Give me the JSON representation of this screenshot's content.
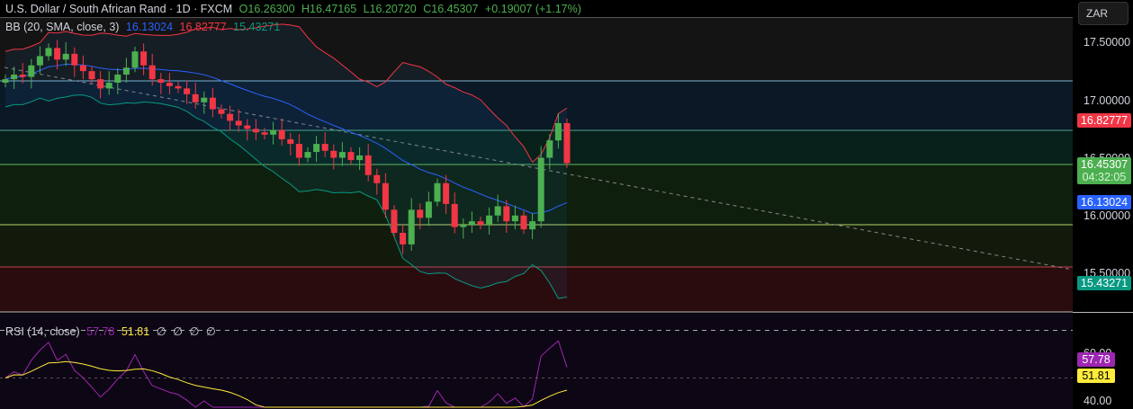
{
  "header": {
    "symbol": "U.S. Dollar / South African Rand · 1D · FXCM",
    "open": "O16.26300",
    "high": "H16.47165",
    "low": "L16.20720",
    "close": "C16.45307",
    "change": "+0.19007 (+1.17%)"
  },
  "bb": {
    "label": "BB (20, SMA, close, 3)",
    "basis": "16.13024",
    "upper": "16.82777",
    "lower": "15.43271"
  },
  "rsi": {
    "label": "RSI (14, close)",
    "value": "57.78",
    "ma": "51.81",
    "extras": [
      "∅",
      "∅",
      "∅",
      "∅"
    ]
  },
  "axis": {
    "currency": "ZAR",
    "ticks": [
      "17.50000",
      "17.00000",
      "16.50000",
      "16.00000",
      "15.50000"
    ],
    "rsi_ticks": [
      "60.00",
      "40.00"
    ],
    "labels": {
      "upper": "16.82777",
      "price": "16.45307",
      "countdown": "04:32:05",
      "basis": "16.13024",
      "lower": "15.43271",
      "rsi": "57.78",
      "rsi_ma": "51.81"
    }
  },
  "colors": {
    "up": "#4caf50",
    "down": "#f23645",
    "basis": "#2962ff",
    "upper": "#f23645",
    "lower": "#089981",
    "rsi": "#9c27b0",
    "rsi_ma": "#ffeb3b"
  },
  "chart_data": {
    "type": "candlestick",
    "ylim": [
      15.2,
      17.75
    ],
    "rsi_ylim": [
      40,
      70
    ],
    "closes": [
      17.18,
      17.22,
      17.2,
      17.3,
      17.38,
      17.45,
      17.35,
      17.4,
      17.3,
      17.25,
      17.18,
      17.1,
      17.15,
      17.22,
      17.28,
      17.42,
      17.3,
      17.18,
      17.15,
      17.12,
      17.1,
      17.05,
      16.98,
      17.02,
      16.92,
      16.88,
      16.82,
      16.78,
      16.75,
      16.72,
      16.7,
      16.74,
      16.66,
      16.62,
      16.5,
      16.55,
      16.62,
      16.56,
      16.5,
      16.55,
      16.48,
      16.52,
      16.35,
      16.28,
      16.05,
      15.85,
      15.75,
      16.05,
      15.98,
      16.12,
      16.28,
      16.1,
      15.9,
      15.92,
      15.95,
      15.92,
      16.0,
      16.08,
      15.95,
      16.0,
      15.88,
      15.95,
      16.5,
      16.65,
      16.8,
      16.453
    ]
  }
}
